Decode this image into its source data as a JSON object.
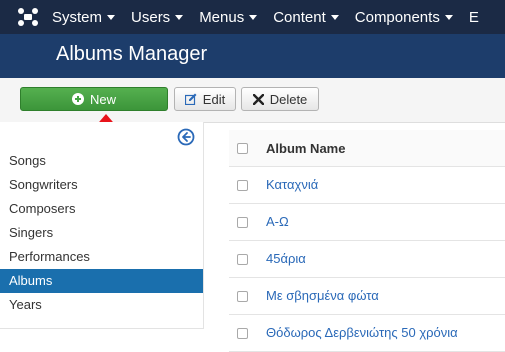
{
  "navbar": {
    "items": [
      {
        "label": "System"
      },
      {
        "label": "Users"
      },
      {
        "label": "Menus"
      },
      {
        "label": "Content"
      },
      {
        "label": "Components"
      },
      {
        "label": "E"
      }
    ]
  },
  "title": "Albums Manager",
  "toolbar": {
    "new_label": "New",
    "edit_label": "Edit",
    "delete_label": "Delete"
  },
  "sidebar": {
    "items": [
      {
        "label": "Songs"
      },
      {
        "label": "Songwriters"
      },
      {
        "label": "Composers"
      },
      {
        "label": "Singers"
      },
      {
        "label": "Performances"
      },
      {
        "label": "Albums"
      },
      {
        "label": "Years"
      }
    ],
    "active_index": 5
  },
  "table": {
    "column_header": "Album Name",
    "rows": [
      {
        "name": "Καταχνιά"
      },
      {
        "name": "Α-Ω"
      },
      {
        "name": "45άρια"
      },
      {
        "name": "Με σβησμένα φώτα"
      },
      {
        "name": "Θόδωρος Δερβενιώτης 50 χρόνια"
      }
    ]
  },
  "colors": {
    "navbar_bg": "#1b2a45",
    "titlebar_bg": "#1d3d6b",
    "new_button": "#46a544",
    "active_item": "#1a6fad",
    "link": "#2a69b8",
    "arrow": "#e8141b"
  }
}
